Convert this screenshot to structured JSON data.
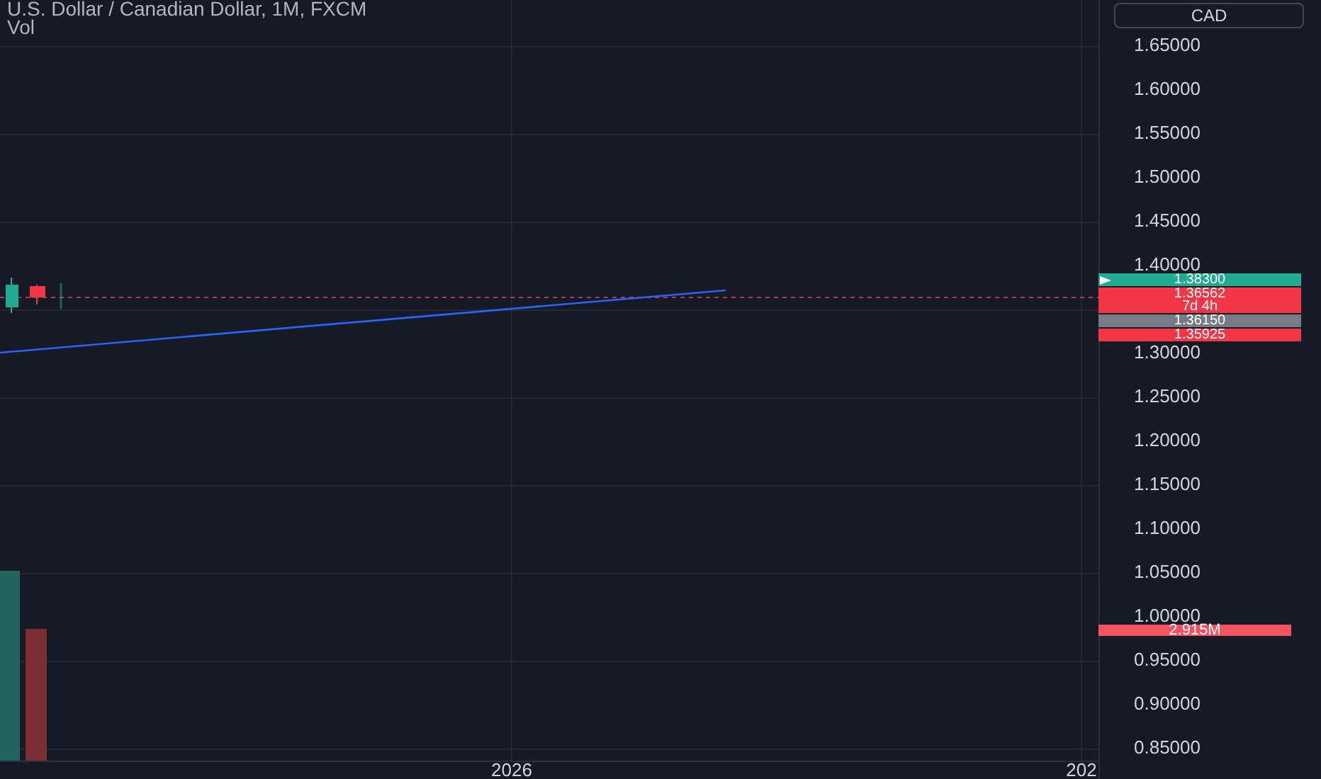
{
  "legend": {
    "title": "U.S. Dollar / Canadian Dollar, 1M, FXCM",
    "volume_study": "Vol"
  },
  "currency_button": "CAD",
  "price_axis": {
    "ticks": [
      "1.65000",
      "1.60000",
      "1.55000",
      "1.50000",
      "1.45000",
      "1.40000",
      "1.30000",
      "1.25000",
      "1.20000",
      "1.15000",
      "1.10000",
      "1.05000",
      "1.00000",
      "0.95000",
      "0.90000",
      "0.85000"
    ]
  },
  "price_labels": [
    {
      "kind": "last",
      "text": "1.38300"
    },
    {
      "kind": "countdown",
      "text": "1.36562",
      "subtext": "7d 4h"
    },
    {
      "kind": "neutral",
      "text": "1.36150"
    },
    {
      "kind": "low",
      "text": "1.35925"
    }
  ],
  "volume_label": "2.915M",
  "time_axis": [
    "2026",
    "202"
  ]
}
